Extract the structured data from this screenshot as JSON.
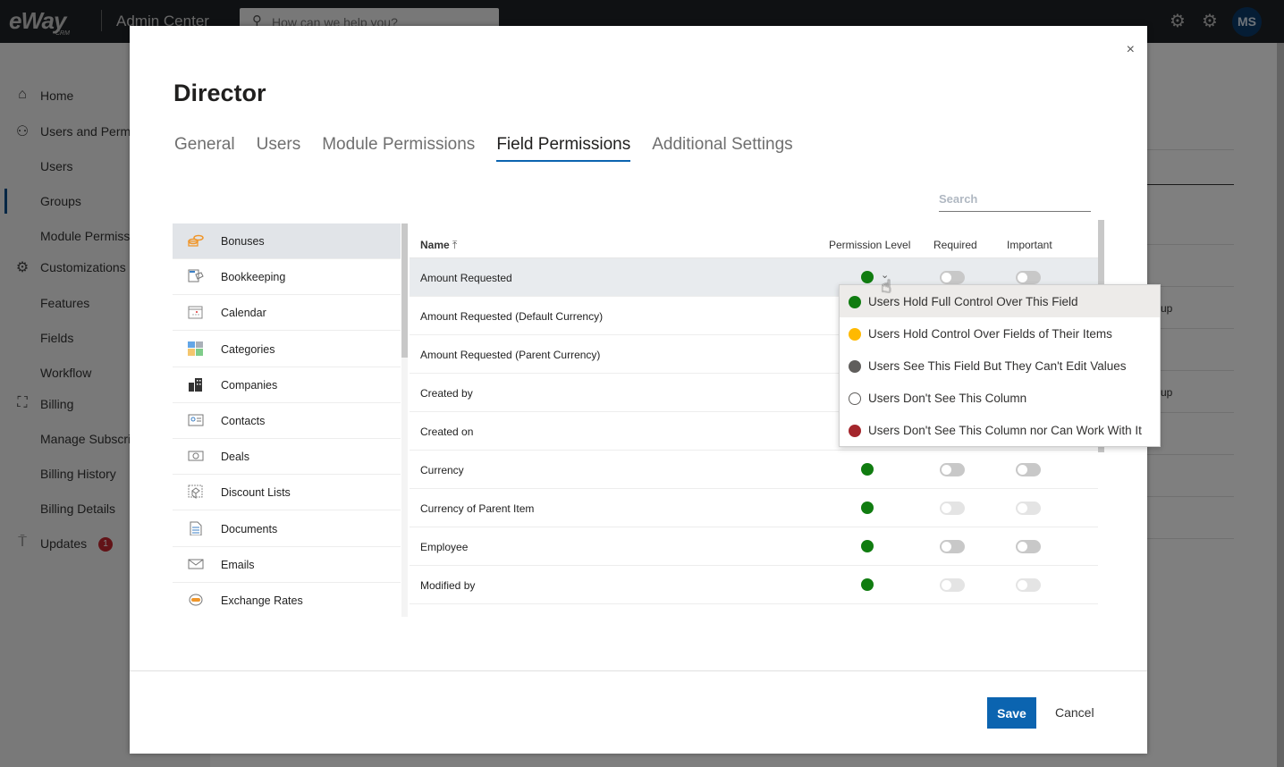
{
  "topbar": {
    "logo": "eWay",
    "logo_sub": "CRM",
    "app_title": "Admin Center",
    "search_placeholder": "How can we help you?",
    "avatar_initials": "MS"
  },
  "sidebar": {
    "items": [
      {
        "label": "Home",
        "icon": "home-icon",
        "glyph": "⌂"
      },
      {
        "label": "Users and Permissions",
        "icon": "user-icon",
        "glyph": "⚇"
      },
      {
        "label": "Users",
        "icon": "",
        "glyph": ""
      },
      {
        "label": "Groups",
        "icon": "",
        "glyph": ""
      },
      {
        "label": "Module Permissions",
        "icon": "",
        "glyph": ""
      },
      {
        "label": "Customizations",
        "icon": "gear-icon",
        "glyph": "⚙"
      },
      {
        "label": "Features",
        "icon": "",
        "glyph": ""
      },
      {
        "label": "Fields",
        "icon": "",
        "glyph": ""
      },
      {
        "label": "Workflow",
        "icon": "",
        "glyph": ""
      },
      {
        "label": "Billing",
        "icon": "shopping-bag-icon",
        "glyph": "⛶"
      },
      {
        "label": "Manage Subscription",
        "icon": "",
        "glyph": ""
      },
      {
        "label": "Billing History",
        "icon": "",
        "glyph": ""
      },
      {
        "label": "Billing Details",
        "icon": "",
        "glyph": ""
      },
      {
        "label": "Updates",
        "icon": "updates-icon",
        "glyph": "⍑",
        "badge": "1"
      }
    ],
    "active": "Groups"
  },
  "background": {
    "fragments": [
      "up",
      "up"
    ]
  },
  "modal": {
    "title": "Director",
    "close_glyph": "×",
    "tabs": [
      "General",
      "Users",
      "Module Permissions",
      "Field Permissions",
      "Additional Settings"
    ],
    "active_tab": "Field Permissions",
    "search_placeholder": "Search",
    "modules": [
      {
        "label": "Bonuses",
        "icon": "bonuses-icon"
      },
      {
        "label": "Bookkeeping",
        "icon": "bookkeeping-icon"
      },
      {
        "label": "Calendar",
        "icon": "calendar-icon"
      },
      {
        "label": "Categories",
        "icon": "categories-icon"
      },
      {
        "label": "Companies",
        "icon": "companies-icon"
      },
      {
        "label": "Contacts",
        "icon": "contacts-icon"
      },
      {
        "label": "Deals",
        "icon": "deals-icon"
      },
      {
        "label": "Discount Lists",
        "icon": "discount-lists-icon"
      },
      {
        "label": "Documents",
        "icon": "documents-icon"
      },
      {
        "label": "Emails",
        "icon": "emails-icon"
      },
      {
        "label": "Exchange Rates",
        "icon": "exchange-rates-icon"
      }
    ],
    "selected_module": "Bonuses",
    "columns": {
      "name": "Name",
      "sort_glyph": "⤒",
      "permission_level": "Permission Level",
      "required": "Required",
      "important": "Important"
    },
    "fields": [
      {
        "name": "Amount Requested",
        "permission": "full",
        "required": false,
        "important": false,
        "toggles_enabled": true
      },
      {
        "name": "Amount Requested (Default Currency)",
        "permission": "full",
        "required": false,
        "important": false,
        "toggles_enabled": true
      },
      {
        "name": "Amount Requested (Parent Currency)",
        "permission": "full",
        "required": false,
        "important": false,
        "toggles_enabled": true
      },
      {
        "name": "Created by",
        "permission": "full",
        "required": false,
        "important": false,
        "toggles_enabled": false
      },
      {
        "name": "Created on",
        "permission": "full",
        "required": false,
        "important": false,
        "toggles_enabled": false
      },
      {
        "name": "Currency",
        "permission": "full",
        "required": false,
        "important": false,
        "toggles_enabled": true
      },
      {
        "name": "Currency of Parent Item",
        "permission": "full",
        "required": false,
        "important": false,
        "toggles_enabled": false
      },
      {
        "name": "Employee",
        "permission": "full",
        "required": false,
        "important": false,
        "toggles_enabled": true
      },
      {
        "name": "Modified by",
        "permission": "full",
        "required": false,
        "important": false,
        "toggles_enabled": false
      }
    ],
    "save_label": "Save",
    "cancel_label": "Cancel"
  },
  "permission_dropdown": {
    "options": [
      {
        "key": "full",
        "label": "Users Hold Full Control Over This Field",
        "color": "#107c10"
      },
      {
        "key": "own",
        "label": "Users Hold Control Over Fields of Their Items",
        "color": "#ffb900"
      },
      {
        "key": "read",
        "label": "Users See This Field But They Can't Edit Values",
        "color": "#605e5c"
      },
      {
        "key": "hidden",
        "label": "Users Don't See This Column",
        "color": "#ffffff"
      },
      {
        "key": "none",
        "label": "Users Don't See This Column nor Can Work With It",
        "color": "#a4262c"
      }
    ],
    "highlighted": "full"
  },
  "colors": {
    "accent": "#0b64b0",
    "topbar": "#1f2326",
    "permission_full": "#107c10"
  }
}
